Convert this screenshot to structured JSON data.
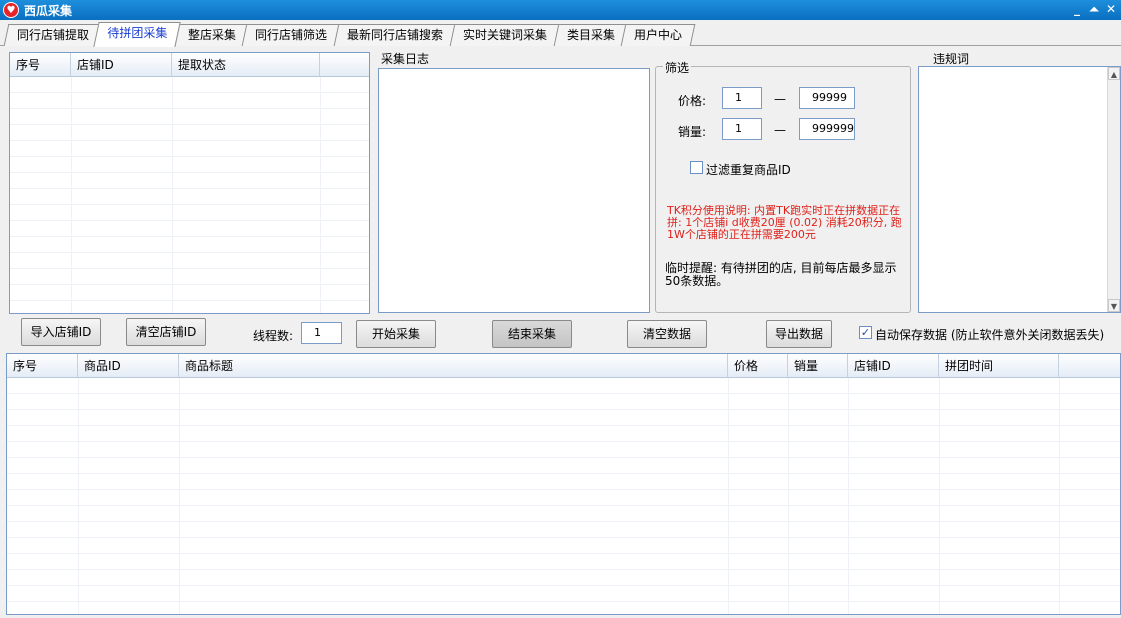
{
  "window": {
    "title": "西瓜采集",
    "app_icon": "watermelon-logo-icon",
    "minimize": "_",
    "maximize": "⏶",
    "close": "✕"
  },
  "tabs": [
    {
      "label": "同行店铺提取"
    },
    {
      "label": "待拼团采集"
    },
    {
      "label": "整店采集"
    },
    {
      "label": "同行店铺筛选"
    },
    {
      "label": "最新同行店铺搜索"
    },
    {
      "label": "实时关键词采集"
    },
    {
      "label": "类目采集"
    },
    {
      "label": "用户中心"
    }
  ],
  "active_tab": "待拼团采集",
  "shop_table": {
    "headers": [
      "序号",
      "店铺ID",
      "提取状态"
    ]
  },
  "log": {
    "label": "采集日志"
  },
  "filter": {
    "title": "筛选",
    "price_label": "价格:",
    "price_min": "1",
    "price_max": "99999",
    "sales_label": "销量:",
    "sales_min": "1",
    "sales_max": "999999",
    "dash": "—",
    "dedup_label": "过滤重复商品ID",
    "dedup_checked": false,
    "tk_note": "TK积分使用说明: 内置TK跑实时正在拼数据正在拼: 1个店铺i d收费20厘 (0.02) 消耗20积分, 跑1W个店铺的正在拼需要200元",
    "reminder": "临时提醒: 有待拼团的店, 目前每店最多显示50条数据。"
  },
  "banned": {
    "label": "违规词"
  },
  "toolbar": {
    "import_shop": "导入店铺ID",
    "clear_shop": "清空店铺ID",
    "threads_label": "线程数:",
    "threads_value": "1",
    "start": "开始采集",
    "stop": "结束采集",
    "clear_data": "清空数据",
    "export": "导出数据",
    "autosave_label": "自动保存数据 (防止软件意外关闭数据丢失)",
    "autosave_checked": true,
    "check_mark": "✓"
  },
  "goods_table": {
    "headers": [
      "序号",
      "商品ID",
      "商品标题",
      "价格",
      "销量",
      "店铺ID",
      "拼团时间"
    ]
  },
  "colors": {
    "titlebar": "#0a6fc0",
    "active_tab_text": "#1a3cd0",
    "note_red": "#e0201a"
  }
}
